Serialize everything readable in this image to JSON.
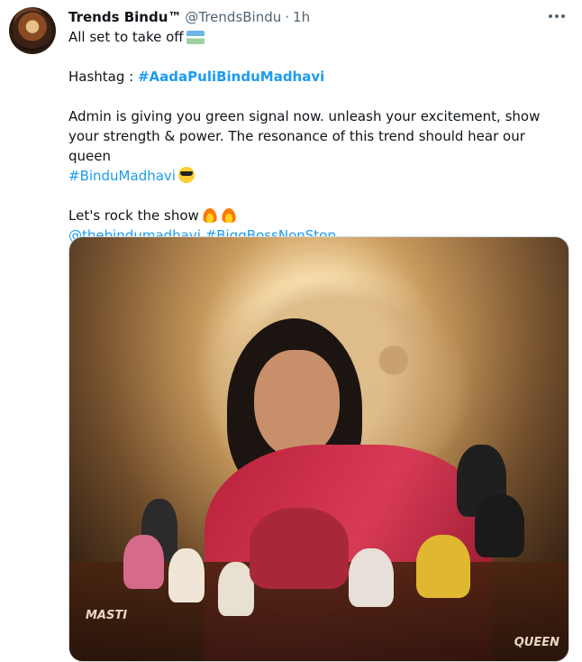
{
  "tweet": {
    "author_name": "Trends Bindu™",
    "handle": "@TrendsBindu",
    "separator": "·",
    "time": "1h",
    "line1_text": "All set to take off",
    "line1_emoji": "airplane-flag-emoji",
    "hashtag_label": "Hashtag : ",
    "hashtag_main": "#AadaPuliBinduMadhavi",
    "para_text": "Admin is giving you green signal now. unleash your excitement, show your strength & power. The resonance of this trend should hear our queen",
    "para_hashtag": "#BinduMadhavi",
    "rock_text": "Let's rock the show",
    "mention": "@thebindumadhavi",
    "tag2": "#BiggBossNonStop",
    "image_label_left": "MASTI",
    "image_label_right": "QUEEN"
  },
  "colors": {
    "link": "#1d9bf0",
    "text": "#0f1419",
    "secondary": "#536471"
  }
}
